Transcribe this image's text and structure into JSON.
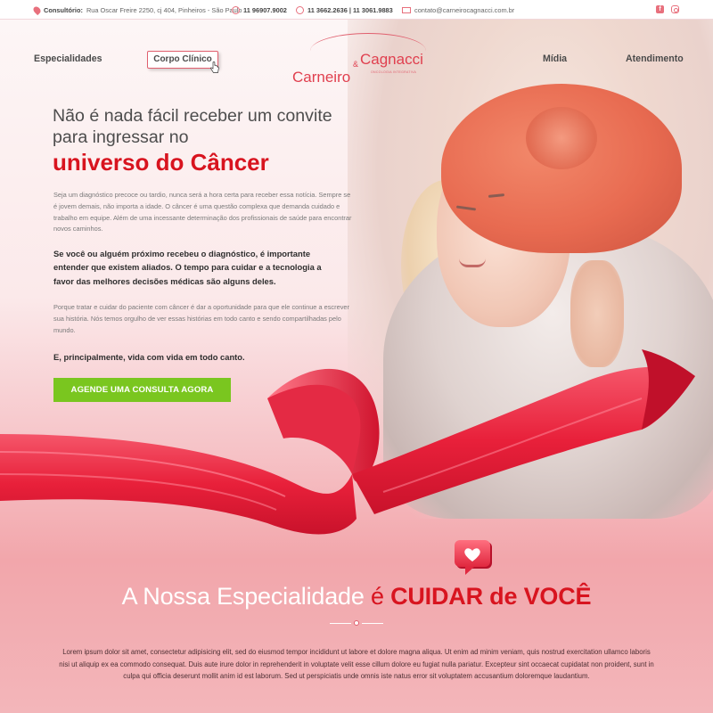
{
  "topbar": {
    "address_label": "Consultório:",
    "address": "Rua Oscar Freire 2250, cj 404, Pinheiros - São Paulo",
    "whatsapp": "11 96907.9002",
    "phones": "11 3662.2636 | 11 3061.9883",
    "email": "contato@carneirocagnacci.com.br",
    "social_facebook_icon": "facebook-icon",
    "social_instagram_icon": "instagram-icon"
  },
  "nav": {
    "especialidades": "Especialidades",
    "corpo_clinico": "Corpo Clínico",
    "midia": "Mídia",
    "atendimento": "Atendimento"
  },
  "logo": {
    "name_a": "Carneiro",
    "amp": "&",
    "name_b": "Cagnacci",
    "tagline": "ONCOLOGIA INTEGRATIVA"
  },
  "hero": {
    "headline": "Não é nada fácil receber um convite para ingressar no",
    "headline_highlight": "universo do Câncer",
    "paragraph1": "Seja um diagnóstico precoce ou tardio, nunca será a hora certa para receber essa notícia. Sempre se é jovem demais, não importa a idade. O câncer é uma questão complexa que demanda cuidado e trabalho em equipe. Além de uma incessante determinação dos profissionais de saúde para encontrar novos caminhos.",
    "paragraph2": "Se você ou alguém próximo recebeu o diagnóstico, é importante entender que existem aliados. O tempo para cuidar e a tecnologia a favor das melhores decisões médicas são alguns deles.",
    "paragraph3": "Porque tratar e cuidar do paciente com câncer é dar a oportunidade para que ele continue a escrever sua história. Nós temos orgulho de ver essas histórias em todo canto e sendo compartilhadas pelo mundo.",
    "paragraph4": "E, principalmente, vida com vida em todo canto.",
    "cta": "AGENDE UMA CONSULTA AGORA"
  },
  "specialty": {
    "part1": "A Nossa Especialidade ",
    "part2": "é ",
    "part3": "CUIDAR de VOCÊ",
    "lorem": "Lorem ipsum dolor sit amet, consectetur adipisicing elit, sed do eiusmod tempor incididunt ut labore et dolore magna aliqua. Ut enim ad minim veniam, quis nostrud exercitation ullamco laboris nisi ut aliquip ex ea commodo consequat. Duis aute irure dolor in reprehenderit in voluptate velit esse cillum dolore eu fugiat nulla pariatur. Excepteur sint occaecat cupidatat non proident, sunt in culpa qui officia deserunt mollit anim id est laborum. Sed ut perspiciatis unde omnis iste natus error sit voluptatem accusantium doloremque laudantium."
  },
  "colors": {
    "brand_red": "#d8141f",
    "accent_pink": "#e05f6e",
    "cta_green": "#7ac61f"
  }
}
